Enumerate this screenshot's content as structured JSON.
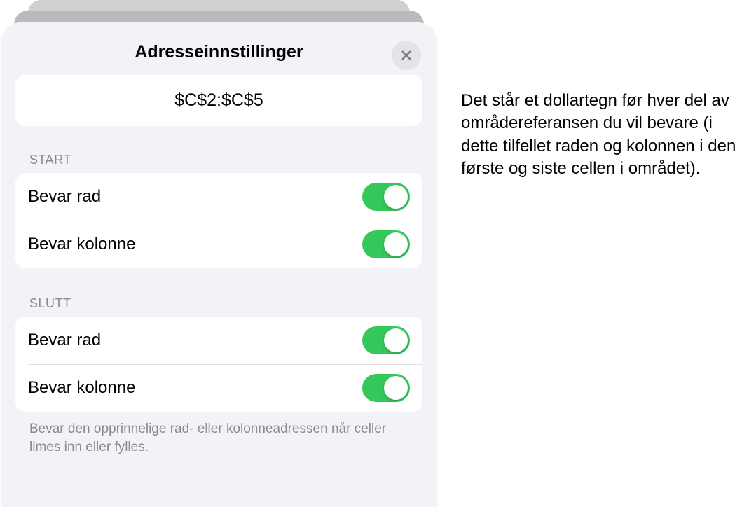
{
  "header": {
    "title": "Adresseinnstillinger"
  },
  "address_field": {
    "value": "$C$2:$C$5"
  },
  "sections": {
    "start": {
      "header": "START",
      "preserve_row": "Bevar rad",
      "preserve_column": "Bevar kolonne"
    },
    "end": {
      "header": "SLUTT",
      "preserve_row": "Bevar rad",
      "preserve_column": "Bevar kolonne"
    }
  },
  "footer": "Bevar den opprinnelige rad- eller kolonneadressen når celler limes inn eller fylles.",
  "callout": "Det står et dollartegn før hver del av områdereferansen du vil bevare (i dette tilfellet raden og kolonnen i den første og siste cellen i området)."
}
